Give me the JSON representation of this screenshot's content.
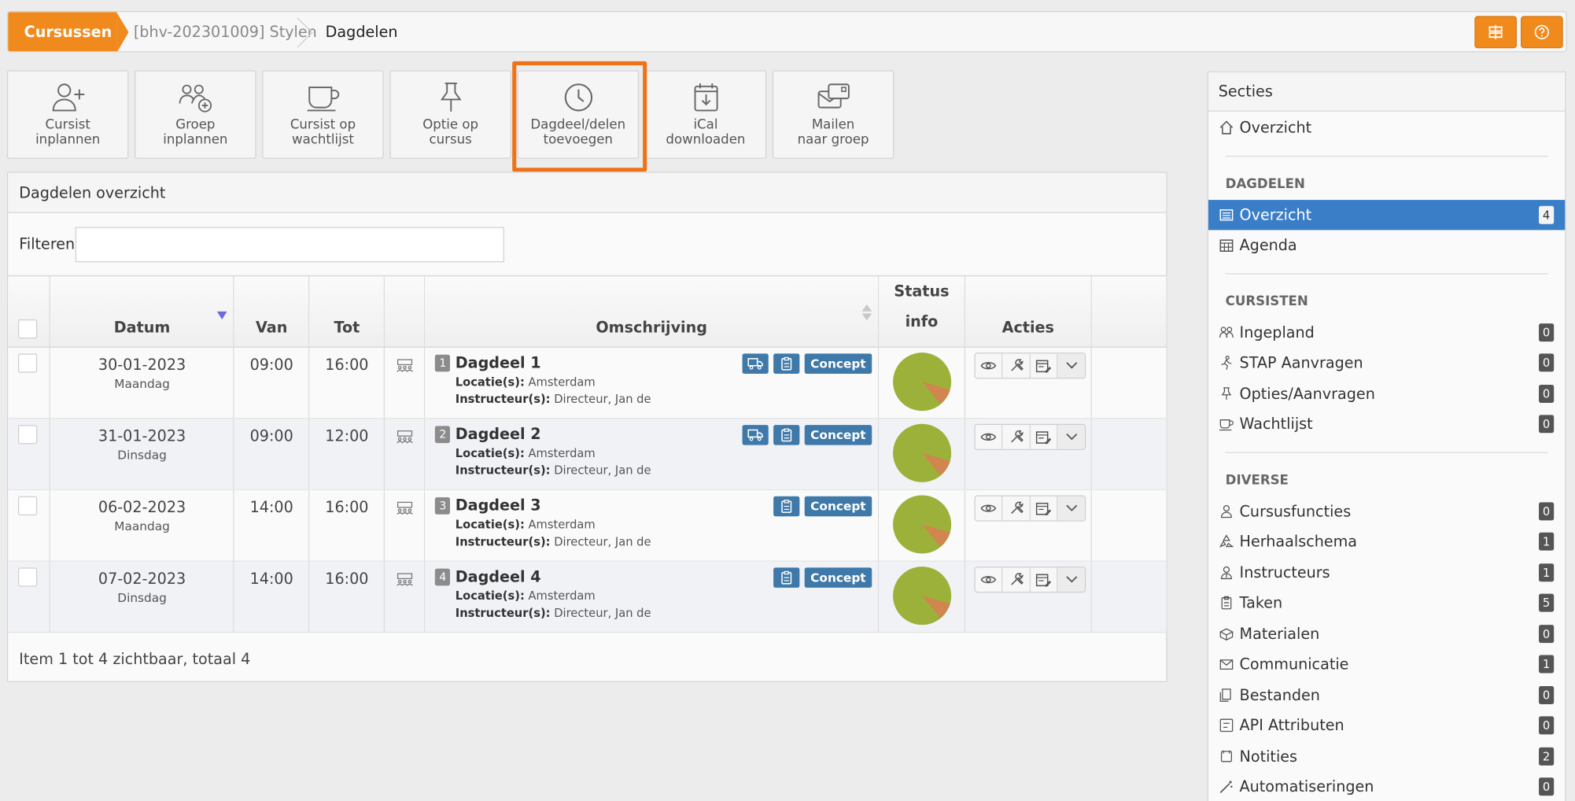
{
  "breadcrumb": {
    "root": "Cursussen",
    "course": "[bhv-202301009] Stylen",
    "current": "Dagdelen"
  },
  "toolbar": [
    {
      "label1": "Cursist",
      "label2": "inplannen",
      "icon": "user-plus-icon"
    },
    {
      "label1": "Groep",
      "label2": "inplannen",
      "icon": "users-plus-icon"
    },
    {
      "label1": "Cursist op",
      "label2": "wachtlijst",
      "icon": "coffee-icon"
    },
    {
      "label1": "Optie op",
      "label2": "cursus",
      "icon": "pin-icon"
    },
    {
      "label1": "Dagdeel/delen",
      "label2": "toevoegen",
      "icon": "clock-icon"
    },
    {
      "label1": "iCal",
      "label2": "downloaden",
      "icon": "calendar-download-icon"
    },
    {
      "label1": "Mailen",
      "label2": "naar groep",
      "icon": "mail-group-icon"
    }
  ],
  "panel": {
    "title": "Dagdelen overzicht",
    "filter_label": "Filteren",
    "filter_value": "",
    "columns": {
      "datum": "Datum",
      "van": "Van",
      "tot": "Tot",
      "omschrijving": "Omschrijving",
      "status1": "Status",
      "status2": "info",
      "acties": "Acties"
    },
    "footer": "Item 1 tot 4 zichtbaar, totaal 4",
    "meta_labels": {
      "locatie": "Locatie(s):",
      "instructeur": "Instructeur(s):"
    }
  },
  "rows": [
    {
      "date": "30-01-2023",
      "day": "Maandag",
      "van": "09:00",
      "tot": "16:00",
      "num": "1",
      "title": "Dagdeel 1",
      "locatie": "Amsterdam",
      "instructeur": "Directeur, Jan de",
      "status": "Concept",
      "truck": true
    },
    {
      "date": "31-01-2023",
      "day": "Dinsdag",
      "van": "09:00",
      "tot": "12:00",
      "num": "2",
      "title": "Dagdeel 2",
      "locatie": "Amsterdam",
      "instructeur": "Directeur, Jan de",
      "status": "Concept",
      "truck": true
    },
    {
      "date": "06-02-2023",
      "day": "Maandag",
      "van": "14:00",
      "tot": "16:00",
      "num": "3",
      "title": "Dagdeel 3",
      "locatie": "Amsterdam",
      "instructeur": "Directeur, Jan de",
      "status": "Concept",
      "truck": false
    },
    {
      "date": "07-02-2023",
      "day": "Dinsdag",
      "van": "14:00",
      "tot": "16:00",
      "num": "4",
      "title": "Dagdeel 4",
      "locatie": "Amsterdam",
      "instructeur": "Directeur, Jan de",
      "status": "Concept",
      "truck": false
    }
  ],
  "colors": {
    "orange": "#f08a1d",
    "blue": "#3e79a9",
    "active": "#3a7ec8",
    "pie_green": "#9cb13a",
    "pie_slice": "#d0864e"
  },
  "sidebar": {
    "title": "Secties",
    "overview": "Overzicht",
    "sections": [
      {
        "heading": "DAGDELEN",
        "items": [
          {
            "label": "Overzicht",
            "count": "4",
            "active": true,
            "icon": "list-icon"
          },
          {
            "label": "Agenda",
            "count": "",
            "icon": "calendar-grid-icon"
          }
        ]
      },
      {
        "heading": "CURSISTEN",
        "items": [
          {
            "label": "Ingepland",
            "count": "0",
            "icon": "users-icon"
          },
          {
            "label": "STAP Aanvragen",
            "count": "0",
            "icon": "walk-icon"
          },
          {
            "label": "Opties/Aanvragen",
            "count": "0",
            "icon": "pin-icon"
          },
          {
            "label": "Wachtlijst",
            "count": "0",
            "icon": "coffee-icon"
          }
        ]
      },
      {
        "heading": "DIVERSE",
        "items": [
          {
            "label": "Cursusfuncties",
            "count": "0",
            "icon": "user-icon"
          },
          {
            "label": "Herhaalschema",
            "count": "1",
            "icon": "recycle-icon"
          },
          {
            "label": "Instructeurs",
            "count": "1",
            "icon": "instructor-icon"
          },
          {
            "label": "Taken",
            "count": "5",
            "icon": "clipboard-icon"
          },
          {
            "label": "Materialen",
            "count": "0",
            "icon": "box-icon"
          },
          {
            "label": "Communicatie",
            "count": "1",
            "icon": "mail-icon"
          },
          {
            "label": "Bestanden",
            "count": "0",
            "icon": "files-icon"
          },
          {
            "label": "API Attributen",
            "count": "0",
            "icon": "api-icon"
          },
          {
            "label": "Notities",
            "count": "2",
            "icon": "notes-icon"
          },
          {
            "label": "Automatiseringen",
            "count": "0",
            "icon": "wand-icon"
          }
        ]
      }
    ]
  }
}
